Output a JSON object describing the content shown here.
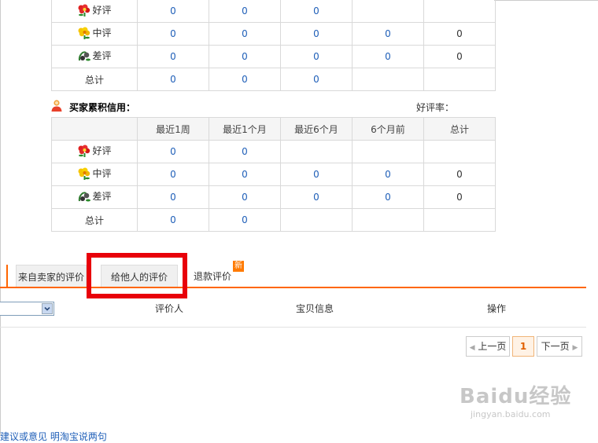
{
  "top_table": {
    "rows": [
      {
        "label": "好评",
        "icon": "red-flower-icon",
        "values": [
          "0",
          "0",
          "0",
          "",
          ""
        ]
      },
      {
        "label": "中评",
        "icon": "yellow-flower-icon",
        "values": [
          "0",
          "0",
          "0",
          "0",
          "0"
        ]
      },
      {
        "label": "差评",
        "icon": "wilted-flower-icon",
        "values": [
          "0",
          "0",
          "0",
          "0",
          "0"
        ]
      },
      {
        "label": "总计",
        "icon": "",
        "values": [
          "0",
          "0",
          "0",
          "",
          ""
        ]
      }
    ]
  },
  "buyer_credit": {
    "title": "买家累积信用：",
    "rate_label": "好评率：",
    "headers": [
      "",
      "最近1周",
      "最近1个月",
      "最近6个月",
      "6个月前",
      "总计"
    ],
    "rows": [
      {
        "label": "好评",
        "icon": "red-flower-icon",
        "values": [
          "0",
          "0",
          "",
          "",
          ""
        ]
      },
      {
        "label": "中评",
        "icon": "yellow-flower-icon",
        "values": [
          "0",
          "0",
          "0",
          "0",
          "0"
        ]
      },
      {
        "label": "差评",
        "icon": "wilted-flower-icon",
        "values": [
          "0",
          "0",
          "0",
          "0",
          "0"
        ]
      },
      {
        "label": "总计",
        "icon": "",
        "values": [
          "0",
          "0",
          "",
          "",
          ""
        ]
      }
    ]
  },
  "tabs": [
    {
      "label": "来自卖家的评价"
    },
    {
      "label": "给他人的评价"
    },
    {
      "label": "退款评价"
    }
  ],
  "new_badge": "新",
  "list_headers": {
    "reviewer": "评价人",
    "item_info": "宝贝信息",
    "action": "操作"
  },
  "pager": {
    "prev": "上一页",
    "current": "1",
    "next": "下一页"
  },
  "watermark": {
    "brand": "Baidu经验",
    "url": "jingyan.baidu.com"
  },
  "footer_fragment": "建议或意见    明淘宝说两句"
}
